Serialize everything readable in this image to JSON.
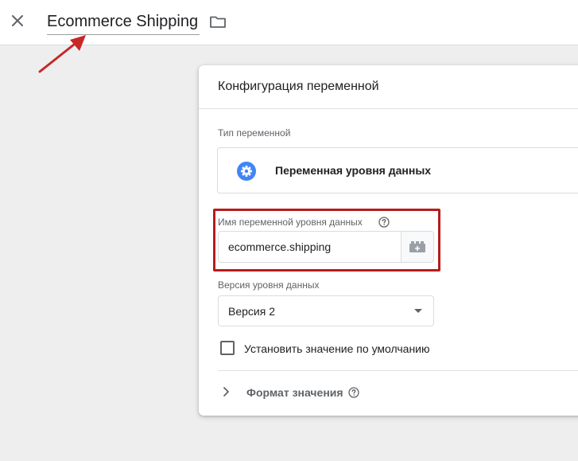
{
  "header": {
    "title": "Ecommerce Shipping",
    "close_icon": "close-icon",
    "folder_icon": "folder-icon"
  },
  "card": {
    "title": "Конфигурация переменной",
    "variable_type": {
      "label": "Тип переменной",
      "value": "Переменная уровня данных",
      "icon": "gear-icon",
      "icon_color": "#4285f4"
    },
    "variable_name": {
      "label": "Имя переменной уровня данных",
      "value": "ecommerce.shipping",
      "help_icon": "help-icon",
      "variable_icon": "variable-picker-icon"
    },
    "version": {
      "label": "Версия уровня данных",
      "selected": "Версия 2"
    },
    "default_value": {
      "label": "Установить значение по умолчанию",
      "checked": false
    },
    "format": {
      "label": "Формат значения",
      "expanded": false
    }
  },
  "colors": {
    "accent": "#4285f4",
    "highlight": "#b71c1c",
    "arrow": "#c62828"
  }
}
